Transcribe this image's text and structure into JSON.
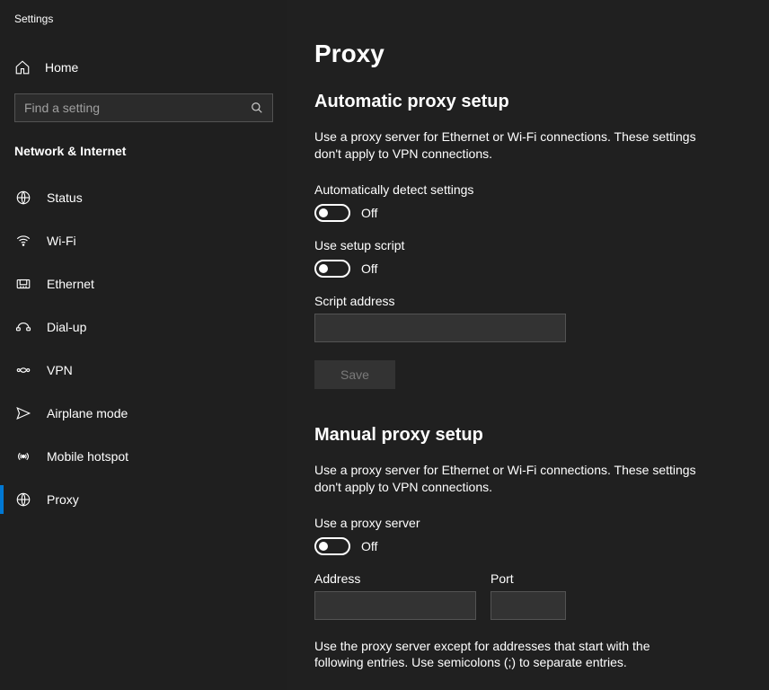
{
  "app": {
    "title": "Settings"
  },
  "home": {
    "label": "Home"
  },
  "search": {
    "placeholder": "Find a setting"
  },
  "category": "Network & Internet",
  "nav": [
    {
      "key": "status",
      "label": "Status"
    },
    {
      "key": "wifi",
      "label": "Wi-Fi"
    },
    {
      "key": "ethernet",
      "label": "Ethernet"
    },
    {
      "key": "dialup",
      "label": "Dial-up"
    },
    {
      "key": "vpn",
      "label": "VPN"
    },
    {
      "key": "airplane",
      "label": "Airplane mode"
    },
    {
      "key": "hotspot",
      "label": "Mobile hotspot"
    },
    {
      "key": "proxy",
      "label": "Proxy"
    }
  ],
  "page": {
    "title": "Proxy",
    "auto": {
      "heading": "Automatic proxy setup",
      "desc": "Use a proxy server for Ethernet or Wi-Fi connections. These settings don't apply to VPN connections.",
      "detect_label": "Automatically detect settings",
      "detect_state": "Off",
      "script_label": "Use setup script",
      "script_state": "Off",
      "script_addr_label": "Script address",
      "script_addr_value": "",
      "save_label": "Save"
    },
    "manual": {
      "heading": "Manual proxy setup",
      "desc": "Use a proxy server for Ethernet or Wi-Fi connections. These settings don't apply to VPN connections.",
      "use_label": "Use a proxy server",
      "use_state": "Off",
      "addr_label": "Address",
      "addr_value": "",
      "port_label": "Port",
      "port_value": "",
      "exceptions_desc": "Use the proxy server except for addresses that start with the following entries. Use semicolons (;) to separate entries."
    }
  }
}
